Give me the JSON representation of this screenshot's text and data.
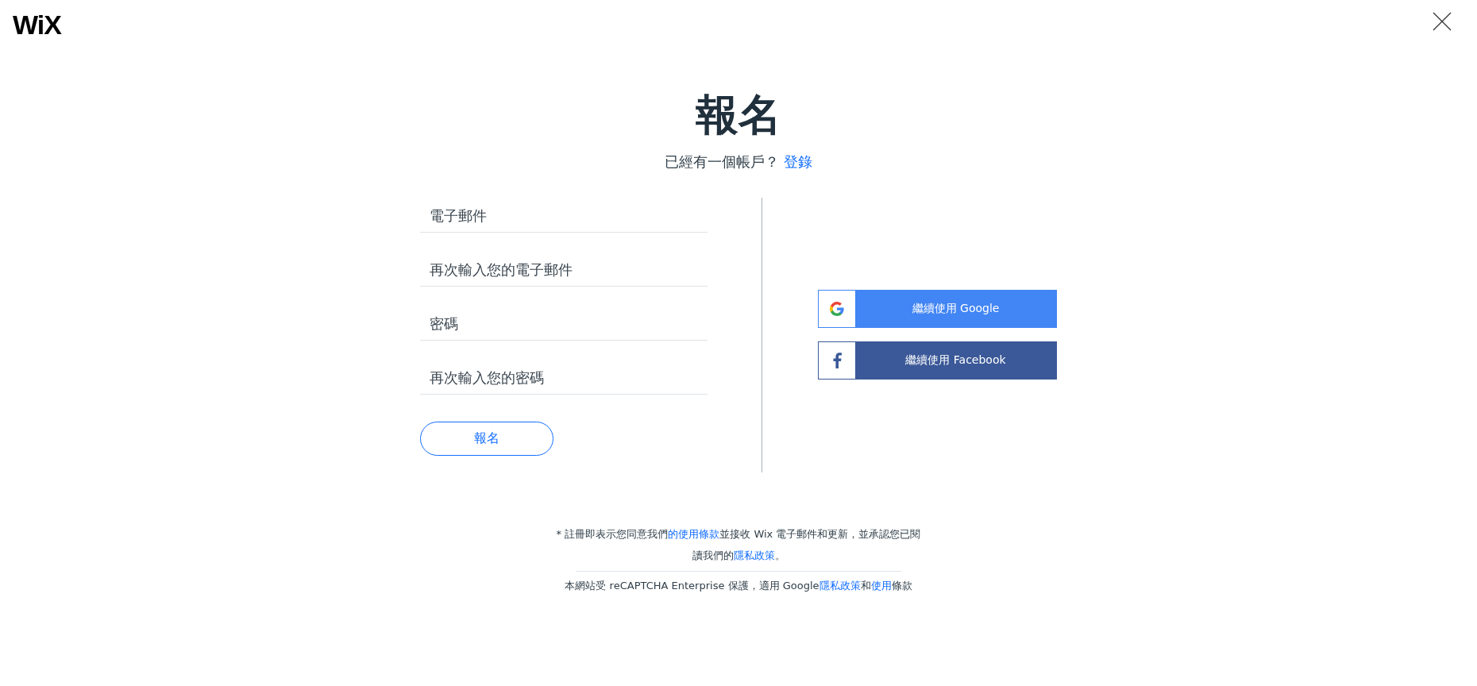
{
  "header": {
    "logo": "WiX"
  },
  "title": "報名",
  "subtitle": {
    "text": "已經有一個帳戶？",
    "link": "登錄"
  },
  "fields": [
    {
      "placeholder": "電子郵件"
    },
    {
      "placeholder": "再次輸入您的電子郵件"
    },
    {
      "placeholder": "密碼"
    },
    {
      "placeholder": "再次輸入您的密碼"
    }
  ],
  "submit": "報名",
  "social": [
    {
      "kind": "google",
      "label": "繼續使用 Google"
    },
    {
      "kind": "facebook",
      "label": "繼續使用 Facebook"
    }
  ],
  "footer": {
    "terms": [
      {
        "kind": "text",
        "text": "* 註冊即表示您同意我們"
      },
      {
        "kind": "link",
        "text": "的使用條款"
      },
      {
        "kind": "text",
        "text": "並接收 Wix 電子郵件和更新，並承認您已閱讀我們的"
      },
      {
        "kind": "link",
        "text": "隱私政策"
      },
      {
        "kind": "text",
        "text": "。"
      }
    ],
    "recaptcha": [
      {
        "kind": "text",
        "text": "本網站受 reCAPTCHA Enterprise 保護，適用 Google"
      },
      {
        "kind": "link",
        "text": "隱私政策"
      },
      {
        "kind": "text",
        "text": "和"
      },
      {
        "kind": "link",
        "text": "使用"
      },
      {
        "kind": "text",
        "text": "條款"
      }
    ]
  }
}
